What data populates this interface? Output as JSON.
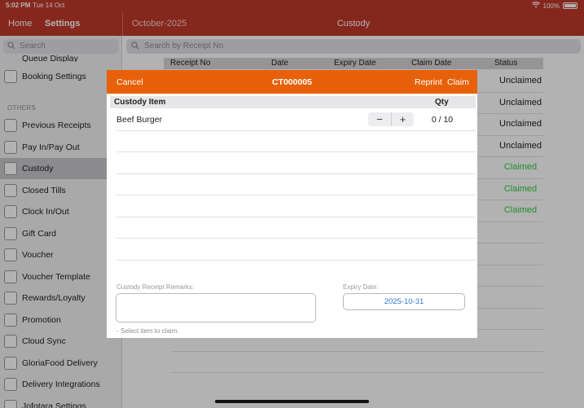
{
  "status_bar": {
    "time": "5:02 PM",
    "date": "Tue 14 Oct",
    "battery": "100%"
  },
  "nav": {
    "home": "Home",
    "settings": "Settings",
    "period": "October-2025",
    "title": "Custody"
  },
  "sidebar": {
    "search_placeholder": "Search",
    "partial_top": "Queue Display",
    "booking": "Booking Settings",
    "section": "OTHERS",
    "items": [
      {
        "label": "Previous Receipts",
        "icon": "receipt-icon"
      },
      {
        "label": "Pay In/Pay Out",
        "icon": "pay-in-out-icon"
      },
      {
        "label": "Custody",
        "icon": "custody-icon",
        "active": true
      },
      {
        "label": "Closed Tills",
        "icon": "till-icon"
      },
      {
        "label": "Clock In/Out",
        "icon": "clock-icon"
      },
      {
        "label": "Gift Card",
        "icon": "gift-card-icon"
      },
      {
        "label": "Voucher",
        "icon": "voucher-icon"
      },
      {
        "label": "Voucher Template",
        "icon": "voucher-template-icon"
      },
      {
        "label": "Rewards/Loyalty",
        "icon": "trophy-icon"
      },
      {
        "label": "Promotion",
        "icon": "promotion-icon"
      },
      {
        "label": "Cloud Sync",
        "icon": "cloud-icon"
      },
      {
        "label": "GloriaFood Delivery",
        "icon": "delivery-icon"
      },
      {
        "label": "Delivery Integrations",
        "icon": "integration-icon"
      },
      {
        "label": "Jofotara Settings",
        "icon": "settings-icon"
      }
    ]
  },
  "main": {
    "search_placeholder": "Search by Receipt No",
    "columns": [
      "Receipt No",
      "Date",
      "Expiry Date",
      "Claim Date",
      "Status"
    ],
    "statuses": [
      "Unclaimed",
      "Unclaimed",
      "Unclaimed",
      "Unclaimed",
      "Claimed",
      "Claimed",
      "Claimed"
    ],
    "colors": {
      "unclaimed": "#222222",
      "claimed": "#2ecc40"
    }
  },
  "modal": {
    "cancel": "Cancel",
    "title": "CT000005",
    "reprint": "Reprint",
    "claim": "Claim",
    "col_item": "Custody Item",
    "col_qty": "Qty",
    "items": [
      {
        "name": "Beef Burger",
        "qty": "0 / 10"
      }
    ],
    "remarks_label": "Custody Receipt Remarks:",
    "remarks_value": "",
    "expiry_label": "Expiry Date:",
    "expiry_value": "2025-10-31",
    "hint": "- Select item to claim."
  },
  "colors": {
    "header": "#c0392b",
    "modal_header": "#e8610a",
    "link": "#3478c9"
  }
}
